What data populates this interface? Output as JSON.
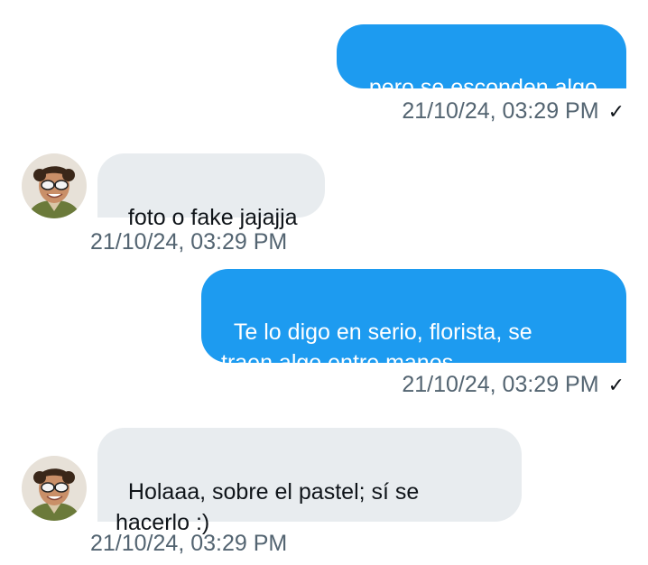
{
  "messages": [
    {
      "direction": "outgoing",
      "text": "pero se esconden algo",
      "timestamp": "21/10/24, 03:29 PM",
      "status_icon": "✓"
    },
    {
      "direction": "incoming",
      "text": "foto o fake jajajja",
      "timestamp": "21/10/24, 03:29 PM",
      "avatar": "user-avatar"
    },
    {
      "direction": "outgoing",
      "text": "Te lo digo en serio, florista, se\ntraen algo entre manos",
      "timestamp": "21/10/24, 03:29 PM",
      "status_icon": "✓"
    },
    {
      "direction": "incoming",
      "text": "Holaaa, sobre el pastel; sí se\nhacerlo :)",
      "timestamp": "21/10/24, 03:29 PM",
      "avatar": "user-avatar"
    }
  ],
  "colors": {
    "outgoing_bubble": "#1d9bf0",
    "incoming_bubble": "#e8ecef",
    "timestamp": "#536471"
  }
}
